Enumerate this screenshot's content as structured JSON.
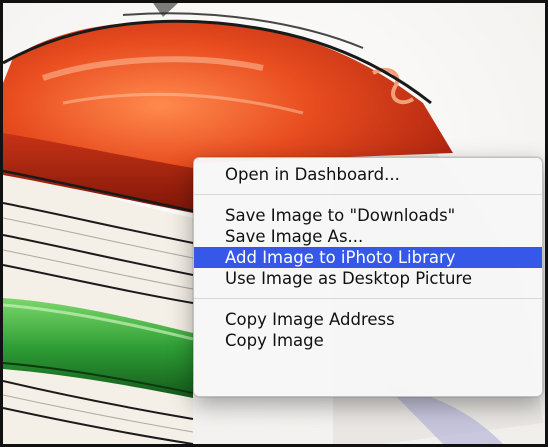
{
  "context_menu": {
    "groups": [
      {
        "items": [
          {
            "label": "Open in Dashboard...",
            "highlighted": false
          }
        ]
      },
      {
        "items": [
          {
            "label": "Save Image to \"Downloads\"",
            "highlighted": false
          },
          {
            "label": "Save Image As...",
            "highlighted": false
          },
          {
            "label": "Add Image to iPhoto Library",
            "highlighted": true
          },
          {
            "label": "Use Image as Desktop Picture",
            "highlighted": false
          }
        ]
      },
      {
        "items": [
          {
            "label": "Copy Image Address",
            "highlighted": false
          },
          {
            "label": "Copy Image",
            "highlighted": false
          }
        ]
      }
    ],
    "highlight_color": "#3558e8"
  },
  "artwork": {
    "icon": "book-stack-illustration",
    "colors": {
      "red_book": "#d9391a",
      "green_book": "#2f9e3a",
      "pages": "#f3eee6"
    }
  }
}
